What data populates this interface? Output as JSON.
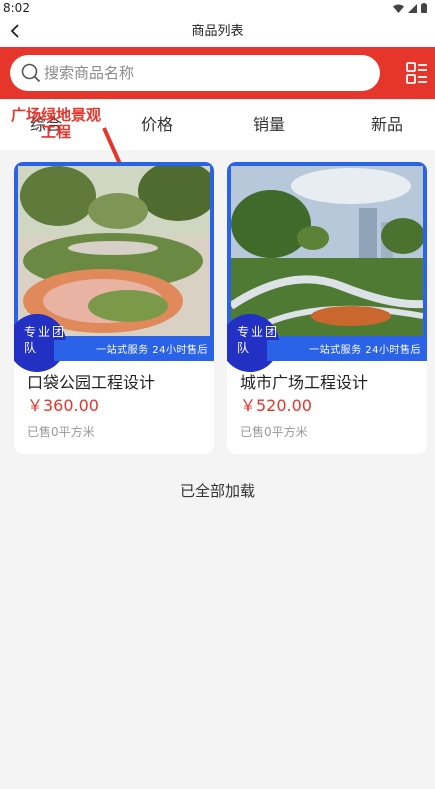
{
  "status_bar": {
    "time": "8:02"
  },
  "nav": {
    "title": "商品列表"
  },
  "search": {
    "placeholder": "搜索商品名称"
  },
  "overlay": {
    "label": "广场绿地景观工程"
  },
  "sort_tabs": [
    "综合",
    "价格",
    "销量",
    "新品"
  ],
  "products": [
    {
      "title": "口袋公园工程设计",
      "price": "￥360.00",
      "sold": "已售0平方米",
      "badge": "专业团队",
      "banner": "一站式服务 24小时售后"
    },
    {
      "title": "城市广场工程设计",
      "price": "￥520.00",
      "sold": "已售0平方米",
      "badge": "专业团队",
      "banner": "一站式服务 24小时售后"
    }
  ],
  "footer": {
    "end_text": "已全部加载"
  },
  "colors": {
    "accent": "#e6352b",
    "badge_blue": "#2a62e8"
  },
  "icons": [
    "wifi-icon",
    "signal-icon",
    "battery-icon",
    "back-icon",
    "search-icon",
    "grid-list-icon"
  ]
}
